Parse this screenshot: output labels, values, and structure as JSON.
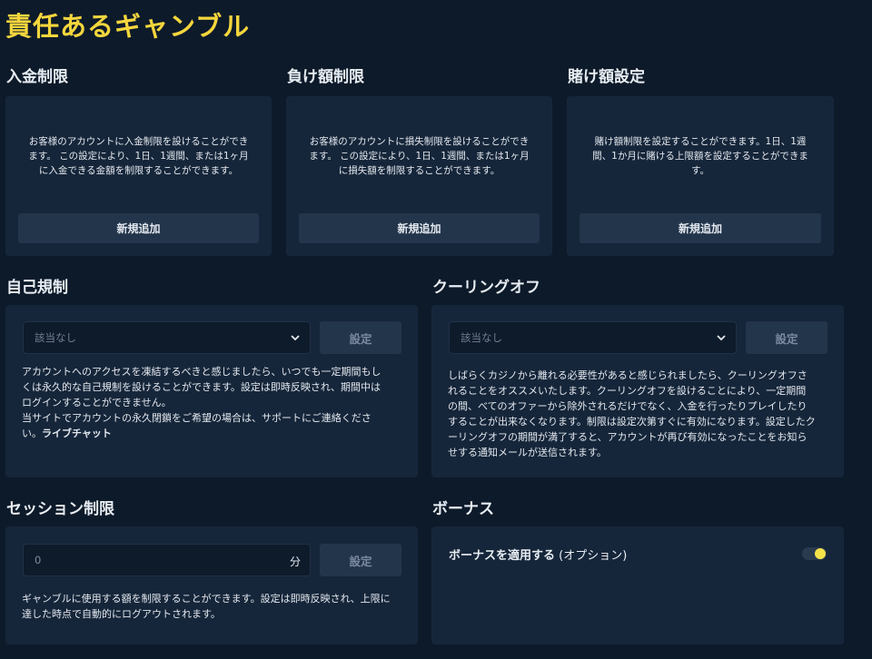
{
  "page": {
    "title": "責任あるギャンブル"
  },
  "deposit_limit": {
    "title": "入金制限",
    "desc_lines": [
      "お客様のアカウントに入金制限を設けることができ",
      "ます。 この設定により、1日、1週間、または1ヶ月",
      "に入金できる金額を制限することができます。"
    ],
    "button": "新規追加"
  },
  "loss_limit": {
    "title": "負け額制限",
    "desc_lines": [
      "お客様のアカウントに損失制限を設けることができ",
      "ます。 この設定により、1日、1週間、または1ヶ月",
      "に損失額を制限することができます。"
    ],
    "button": "新規追加"
  },
  "bet_limit": {
    "title": "賭け額設定",
    "desc_lines": [
      "賭け額制限を設定することができます。1日、1週",
      "間、1か月に賭ける上限額を設定することができま",
      "す。"
    ],
    "button": "新規追加"
  },
  "self_exclusion": {
    "title": "自己規制",
    "select_value": "該当なし",
    "button": "設定",
    "lines": [
      "アカウントへのアクセスを凍結するべきと感じましたら、いつでも一定期間もし",
      "くは永久的な自己規制を設けることができます。設定は即時反映され、期間中は",
      "ログインすることができません。",
      "当サイトでアカウントの永久閉鎖をご希望の場合は、サポートにご連絡くださ"
    ],
    "last_prefix": "い。",
    "link": "ライブチャット"
  },
  "cooling_off": {
    "title": "クーリングオフ",
    "select_value": "該当なし",
    "button": "設定",
    "lines": [
      "しばらくカジノから離れる必要性があると感じられましたら、クーリングオフさ",
      "れることをオススメいたします。クーリングオフを設けることにより、一定期間",
      "の間、べてのオファーから除外されるだけでなく、入金を行ったりプレイしたり",
      "することが出来なくなります。制限は設定次第すぐに有効になります。設定したク",
      "ーリングオフの期間が満了すると、アカウントが再び有効になったことをお知ら",
      "せする通知メールが送信されます。"
    ]
  },
  "session_limit": {
    "title": "セッション制限",
    "input_value": "0",
    "unit": "分",
    "button": "設定",
    "lines": [
      "ギャンブルに使用する額を制限することができます。設定は即時反映され、上限に",
      "達した時点で自動的にログアウトされます。"
    ]
  },
  "bonus": {
    "title": "ボーナス",
    "label": "ボーナスを適用する",
    "optional": "(オプション)",
    "toggle_on": true
  },
  "colors": {
    "accent": "#f5d63d",
    "background": "#0d1a2a",
    "card": "#16263a"
  }
}
